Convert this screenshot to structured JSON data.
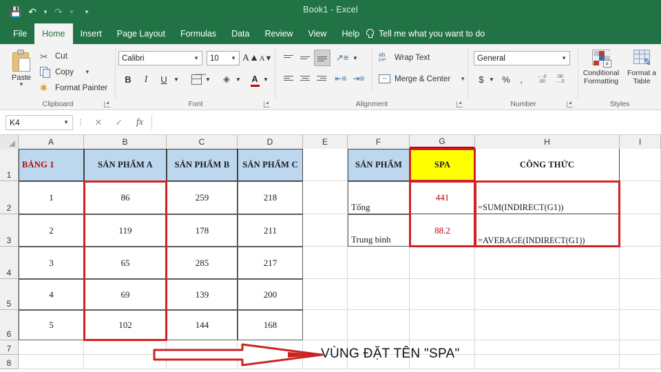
{
  "titlebar": {
    "document_title": "Book1  -  Excel",
    "qat": [
      {
        "name": "save-icon",
        "glyph": "ὋE"
      },
      {
        "name": "undo-icon",
        "glyph": "↶"
      },
      {
        "name": "redo-icon",
        "glyph": "↷"
      },
      {
        "name": "customize-qat-icon",
        "glyph": "☷"
      }
    ]
  },
  "ribbon": {
    "tabs": [
      {
        "label": "File",
        "active": false
      },
      {
        "label": "Home",
        "active": true
      },
      {
        "label": "Insert",
        "active": false
      },
      {
        "label": "Page Layout",
        "active": false
      },
      {
        "label": "Formulas",
        "active": false
      },
      {
        "label": "Data",
        "active": false
      },
      {
        "label": "Review",
        "active": false
      },
      {
        "label": "View",
        "active": false
      },
      {
        "label": "Help",
        "active": false
      }
    ],
    "tell_me": "Tell me what you want to do",
    "groups": {
      "clipboard": {
        "label": "Clipboard",
        "paste": "Paste",
        "cut": "Cut",
        "copy": "Copy",
        "format_painter": "Format Painter"
      },
      "font": {
        "label": "Font",
        "font_family": "Calibri",
        "font_size": "10",
        "grow": "A",
        "shrink": "A",
        "bold": "B",
        "italic": "I",
        "underline": "U"
      },
      "alignment": {
        "label": "Alignment",
        "wrap_text": "Wrap Text",
        "merge_center": "Merge & Center"
      },
      "number": {
        "label": "Number",
        "format": "General",
        "currency": "$",
        "percent": "%",
        "comma": ","
      },
      "styles": {
        "label": "Styles",
        "conditional_formatting": "Conditional\nFormatting",
        "conditional_formatting_l1": "Conditional",
        "conditional_formatting_l2": "Formatting",
        "format_as_table_l1": "Format a",
        "format_as_table_l2": "Table"
      }
    }
  },
  "formula_bar": {
    "name_box": "K4",
    "cancel": "✕",
    "enter": "✓",
    "fx": "fx",
    "formula_value": ""
  },
  "grid": {
    "columns": [
      "A",
      "B",
      "C",
      "D",
      "E",
      "F",
      "G",
      "H",
      "I"
    ],
    "rows": [
      "1",
      "2",
      "3",
      "4",
      "5",
      "6",
      "7",
      "8"
    ],
    "cells": {
      "A1": "BẢNG 1",
      "B1": "SẢN PHẨM A",
      "C1": "SẢN PHẨM B",
      "D1": "SẢN PHẨM C",
      "F1": "SẢN PHẨM",
      "G1": "SPA",
      "H1": "CÔNG THỨC",
      "A2": "1",
      "B2": "86",
      "C2": "259",
      "D2": "218",
      "A3": "2",
      "B3": "119",
      "C3": "178",
      "D3": "211",
      "A4": "3",
      "B4": "65",
      "C4": "285",
      "D4": "217",
      "A5": "4",
      "B5": "69",
      "C5": "139",
      "D5": "200",
      "A6": "5",
      "B6": "102",
      "C6": "144",
      "D6": "168",
      "F2": "Tổng",
      "G2": "441",
      "H2": "=SUM(INDIRECT(G1))",
      "F3": "Trung bình",
      "G3": "88.2",
      "H3": "=AVERAGE(INDIRECT(G1))"
    }
  },
  "annotation": {
    "text": "VÙNG ĐẶT TÊN \"SPA\"",
    "arrow_color": "#cc2222",
    "highlight_color": "#d32020"
  }
}
